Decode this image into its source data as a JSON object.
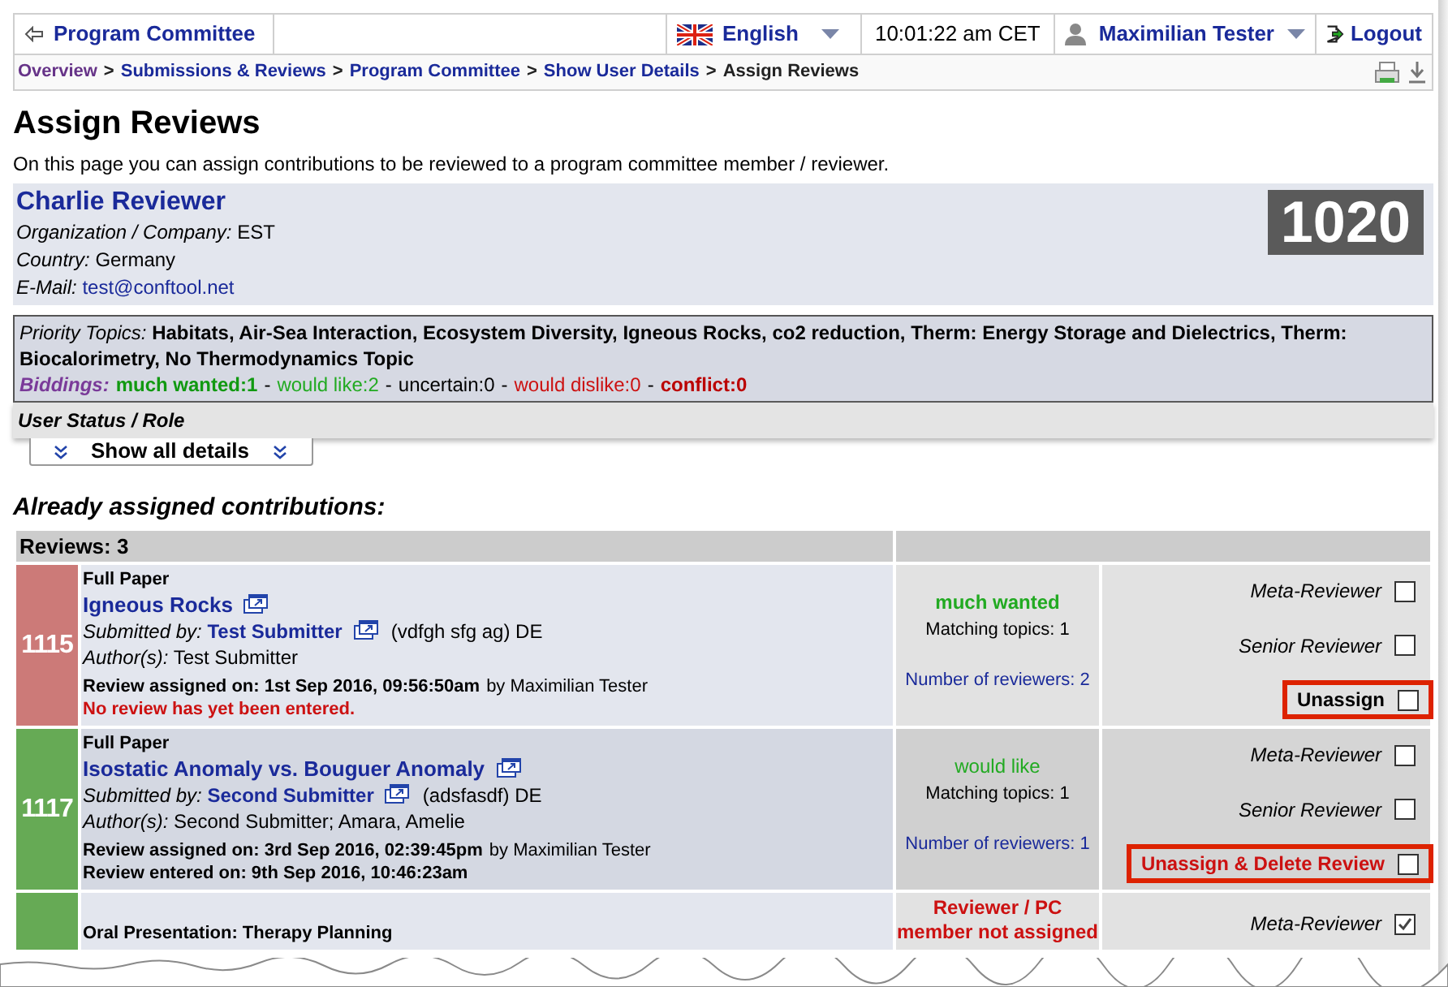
{
  "topbar": {
    "back_link": "Program Committee",
    "language": "English",
    "time": "10:01:22 am CET",
    "user": "Maximilian Tester",
    "logout": "Logout"
  },
  "breadcrumb": [
    {
      "label": "Overview",
      "kind": "visited"
    },
    {
      "label": "Submissions & Reviews",
      "kind": "link"
    },
    {
      "label": "Program Committee",
      "kind": "link"
    },
    {
      "label": "Show User Details",
      "kind": "link"
    },
    {
      "label": "Assign Reviews",
      "kind": "current"
    }
  ],
  "breadcrumb_separator": ">",
  "title": "Assign Reviews",
  "intro": "On this page you can assign contributions to be reviewed to a program committee member / reviewer.",
  "person": {
    "name": "Charlie Reviewer",
    "id": "1020",
    "fields": [
      {
        "label": "Organization / Company:",
        "value": "EST",
        "kind": "text"
      },
      {
        "label": "Country:",
        "value": "Germany",
        "kind": "text"
      },
      {
        "label": "E-Mail:",
        "value": "test@conftool.net",
        "kind": "link"
      }
    ]
  },
  "topics": {
    "label": "Priority Topics:",
    "text": "Habitats, Air-Sea Interaction, Ecosystem Diversity, Igneous Rocks, co2 reduction, Therm: Energy Storage and Dielectrics, Therm: Biocalorimetry, No Thermodynamics Topic"
  },
  "biddings": {
    "label": "Biddings:",
    "separator": "-",
    "items": [
      {
        "text": "much wanted:1",
        "color": "#119911",
        "emphasis": true
      },
      {
        "text": "would like:2",
        "color": "#22aa22",
        "emphasis": false
      },
      {
        "text": "uncertain:0",
        "color": "#000000",
        "emphasis": false
      },
      {
        "text": "would dislike:0",
        "color": "#cc1111",
        "emphasis": false
      },
      {
        "text": "conflict:0",
        "color": "#bb0000",
        "emphasis": true
      }
    ]
  },
  "user_status": "User Status / Role",
  "show_details": "Show all details",
  "section_heading": "Already assigned contributions:",
  "table": {
    "header": "Reviews: 3",
    "rows": [
      {
        "id": "1115",
        "color": "#cc7a78",
        "type": "Full Paper",
        "title": "Igneous Rocks",
        "submitted_label": "Submitted by:",
        "submitter": "Test Submitter",
        "affiliation": "(vdfgh sfg ag) DE",
        "authors_label": "Author(s):",
        "authors": "Test Submitter",
        "notes": [
          {
            "kind": "info",
            "text": "Review assigned on: 1st Sep 2016, 09:56:50am",
            "by": "by Maximilian Tester"
          },
          {
            "kind": "warning",
            "text": "No review has yet been entered."
          }
        ],
        "status": [
          {
            "kind": "bidding_strong",
            "text": "much wanted"
          },
          {
            "kind": "plain",
            "text": "Matching topics: 1"
          },
          {
            "kind": "count",
            "text": "Number of reviewers: 2"
          }
        ],
        "options": [
          {
            "label": "Meta-Reviewer",
            "kind": "role",
            "checked": false,
            "highlighted": false
          },
          {
            "label": "Senior Reviewer",
            "kind": "role",
            "checked": false,
            "highlighted": false
          },
          {
            "label": "Unassign",
            "kind": "unassign",
            "checked": false,
            "highlighted": true
          }
        ]
      },
      {
        "id": "1117",
        "color": "#66aa55",
        "type": "Full Paper",
        "title": "Isostatic Anomaly vs. Bouguer Anomaly",
        "submitted_label": "Submitted by:",
        "submitter": "Second Submitter",
        "affiliation": "(adsfasdf) DE",
        "authors_label": "Author(s):",
        "authors": "Second Submitter; Amara, Amelie",
        "notes": [
          {
            "kind": "info",
            "text": "Review assigned on: 3rd Sep 2016, 02:39:45pm",
            "by": "by Maximilian Tester"
          },
          {
            "kind": "info",
            "text": "Review entered on: 9th Sep 2016, 10:46:23am"
          }
        ],
        "status": [
          {
            "kind": "bidding",
            "text": "would like"
          },
          {
            "kind": "plain",
            "text": "Matching topics: 1"
          },
          {
            "kind": "count",
            "text": "Number of reviewers: 1"
          }
        ],
        "options": [
          {
            "label": "Meta-Reviewer",
            "kind": "role",
            "checked": false,
            "highlighted": false
          },
          {
            "label": "Senior Reviewer",
            "kind": "role",
            "checked": false,
            "highlighted": false
          },
          {
            "label": "Unassign & Delete Review",
            "kind": "delete",
            "checked": false,
            "highlighted": true
          }
        ]
      },
      {
        "id": "",
        "color": "#66aa55",
        "type": "Oral Presentation: Therapy Planning",
        "status": [
          {
            "kind": "alert",
            "text": "Reviewer / PC"
          },
          {
            "kind": "alert",
            "text": "member not assigned"
          }
        ],
        "options": [
          {
            "label": "Meta-Reviewer",
            "kind": "role",
            "checked": true,
            "highlighted": false
          }
        ]
      }
    ]
  }
}
